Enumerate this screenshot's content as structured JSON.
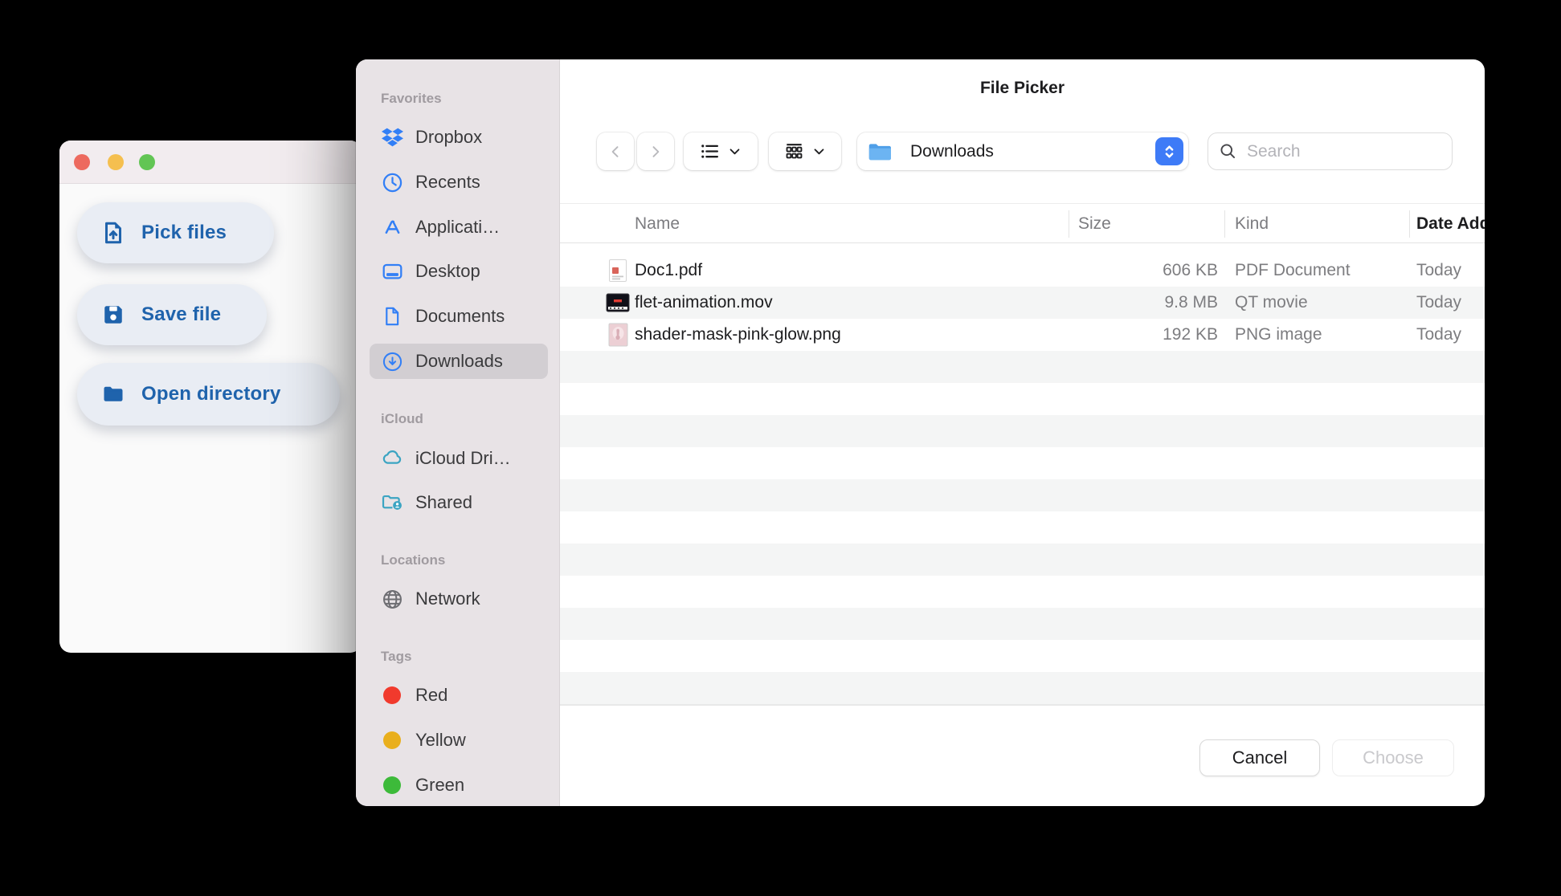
{
  "window": {
    "traffic_lights": [
      "close",
      "minimize",
      "zoom"
    ],
    "buttons": [
      {
        "label": "Pick files",
        "icon": "file-upload-icon"
      },
      {
        "label": "Save file",
        "icon": "floppy-disk-icon"
      },
      {
        "label": "Open directory",
        "icon": "folder-icon"
      }
    ]
  },
  "dialog": {
    "title": "File Picker",
    "toolbar": {
      "back": "chevron-left-icon",
      "forward": "chevron-right-icon",
      "view_list": "list-view-icon",
      "group_by": "group-view-icon",
      "location": "Downloads",
      "search_placeholder": "Search"
    },
    "sidebar": {
      "sections": [
        {
          "header": "Favorites",
          "items": [
            {
              "label": "Dropbox",
              "icon": "dropbox-icon"
            },
            {
              "label": "Recents",
              "icon": "clock-icon"
            },
            {
              "label": "Applicati…",
              "icon": "app-store-icon"
            },
            {
              "label": "Desktop",
              "icon": "desktop-icon"
            },
            {
              "label": "Documents",
              "icon": "document-icon"
            },
            {
              "label": "Downloads",
              "icon": "download-circle-icon",
              "selected": true
            }
          ]
        },
        {
          "header": "iCloud",
          "items": [
            {
              "label": "iCloud Dri…",
              "icon": "cloud-icon"
            },
            {
              "label": "Shared",
              "icon": "shared-folder-icon"
            }
          ]
        },
        {
          "header": "Locations",
          "items": [
            {
              "label": "Network",
              "icon": "globe-icon"
            }
          ]
        },
        {
          "header": "Tags",
          "items": [
            {
              "label": "Red",
              "icon": "red-tag-dot"
            },
            {
              "label": "Yellow",
              "icon": "yellow-tag-dot"
            },
            {
              "label": "Green",
              "icon": "green-tag-dot"
            }
          ]
        }
      ]
    },
    "table": {
      "columns": {
        "name": "Name",
        "size": "Size",
        "kind": "Kind",
        "date_added": "Date Added"
      },
      "rows": [
        {
          "name": "Doc1.pdf",
          "size": "606 KB",
          "kind": "PDF Document",
          "date_added": "Today",
          "icon": "pdf-file-icon"
        },
        {
          "name": "flet-animation.mov",
          "size": "9.8 MB",
          "kind": "QT movie",
          "date_added": "Today",
          "icon": "movie-file-icon"
        },
        {
          "name": "shader-mask-pink-glow.png",
          "size": "192 KB",
          "kind": "PNG image",
          "date_added": "Today",
          "icon": "png-file-icon"
        }
      ]
    },
    "footer": {
      "cancel_label": "Cancel",
      "choose_label": "Choose"
    }
  },
  "colors": {
    "accent_blue": "#1f63ac",
    "sidebar_icon_blue": "#327ff6",
    "sidebar_icon_teal": "#3ba4c2",
    "stepper_blue": "#3e7bf7",
    "tag_red": "#f13a2d",
    "tag_yellow": "#e9af1d",
    "tag_green": "#3dba3a",
    "traffic_red": "#ed6a5f",
    "traffic_yellow": "#f5bf4f",
    "traffic_green": "#62c554"
  }
}
